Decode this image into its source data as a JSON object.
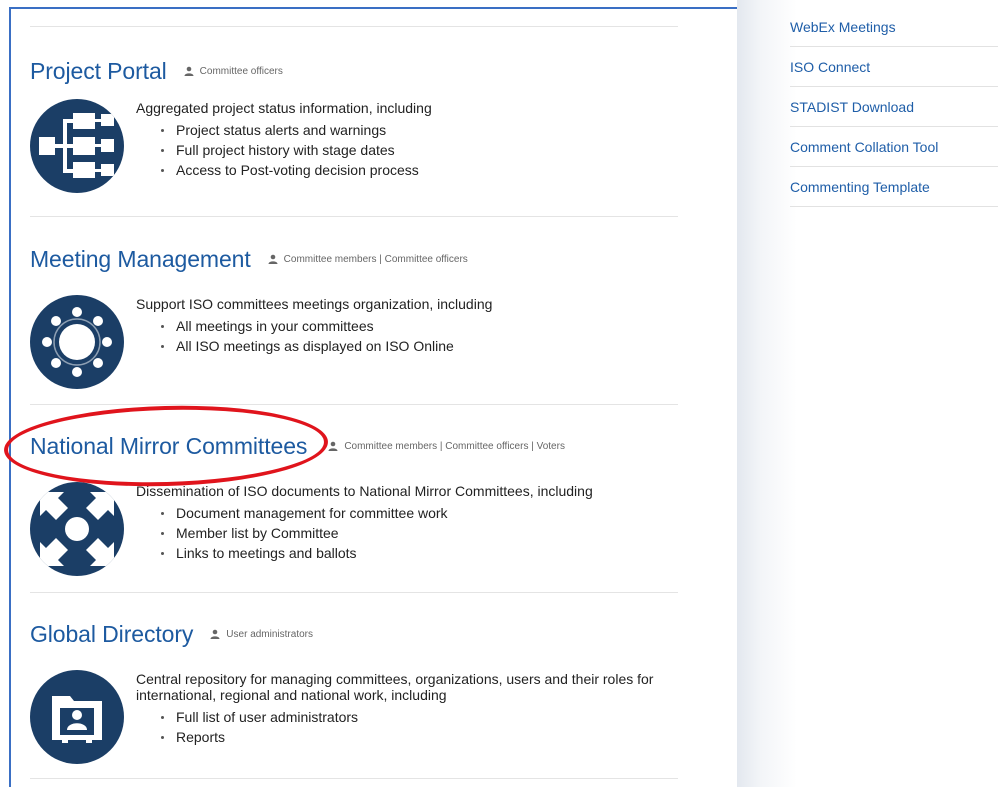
{
  "sidebar": {
    "items": [
      {
        "label": "WebEx Meetings"
      },
      {
        "label": "ISO Connect"
      },
      {
        "label": "STADIST Download"
      },
      {
        "label": "Comment Collation Tool"
      },
      {
        "label": "Commenting Template"
      }
    ]
  },
  "sections": [
    {
      "title": "Project Portal",
      "roles": "Committee officers",
      "icon": "hierarchy-icon",
      "description": "Aggregated project status information, including",
      "bullets": [
        "Project status alerts and warnings",
        "Full project history with stage dates",
        "Access to Post-voting decision process"
      ]
    },
    {
      "title": "Meeting Management",
      "roles": "Committee members | Committee officers",
      "icon": "meeting-circle-icon",
      "description": "Support ISO committees meetings organization, including",
      "bullets": [
        "All meetings in your committees",
        "All ISO meetings as displayed on ISO Online"
      ]
    },
    {
      "title": "National Mirror Committees",
      "roles": "Committee members | Committee officers | Voters",
      "icon": "converging-arrows-icon",
      "description": "Dissemination of ISO documents to National Mirror Committees, including",
      "bullets": [
        "Document management for committee work",
        "Member list by Committee",
        "Links to meetings and ballots"
      ]
    },
    {
      "title": "Global Directory",
      "roles": "User administrators",
      "icon": "directory-folder-icon",
      "description": "Central repository for managing committees, organizations, users and their roles for international, regional and national work, including",
      "bullets": [
        "Full list of user administrators",
        "Reports"
      ]
    }
  ],
  "colors": {
    "title": "#1d5aa0",
    "link": "#1f5ea8",
    "icon_bg": "#1b3e66",
    "highlight": "#e0141c"
  }
}
